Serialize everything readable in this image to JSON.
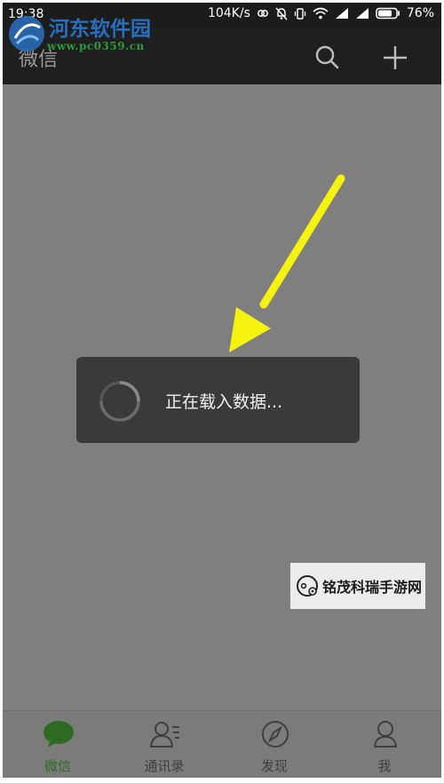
{
  "status_bar": {
    "time": "19:38",
    "network_speed": "104K/s",
    "battery": "76%",
    "icons": [
      "link-icon",
      "alarm-off-icon",
      "vibrate-icon",
      "wifi-icon",
      "signal-icon",
      "signal-icon",
      "battery-icon"
    ]
  },
  "title_bar": {
    "title": "微信",
    "icons": [
      "search-icon",
      "add-icon"
    ]
  },
  "watermark_top": {
    "title": "河东软件园",
    "url": "www.pc0359.cn"
  },
  "loading": {
    "text": "正在载入数据..."
  },
  "watermark_mid": {
    "text": "铭茂科瑞手游网"
  },
  "bottom_nav": {
    "tabs": [
      {
        "label": "微信",
        "icon": "chat-bubble-icon",
        "active": true
      },
      {
        "label": "通讯录",
        "icon": "contacts-icon",
        "active": false
      },
      {
        "label": "发现",
        "icon": "compass-icon",
        "active": false
      },
      {
        "label": "我",
        "icon": "profile-icon",
        "active": false
      }
    ]
  },
  "colors": {
    "accent_green": "#2f6a22",
    "arrow_yellow": "#f6f20f",
    "overlay_gray": "#7f7f7f"
  }
}
